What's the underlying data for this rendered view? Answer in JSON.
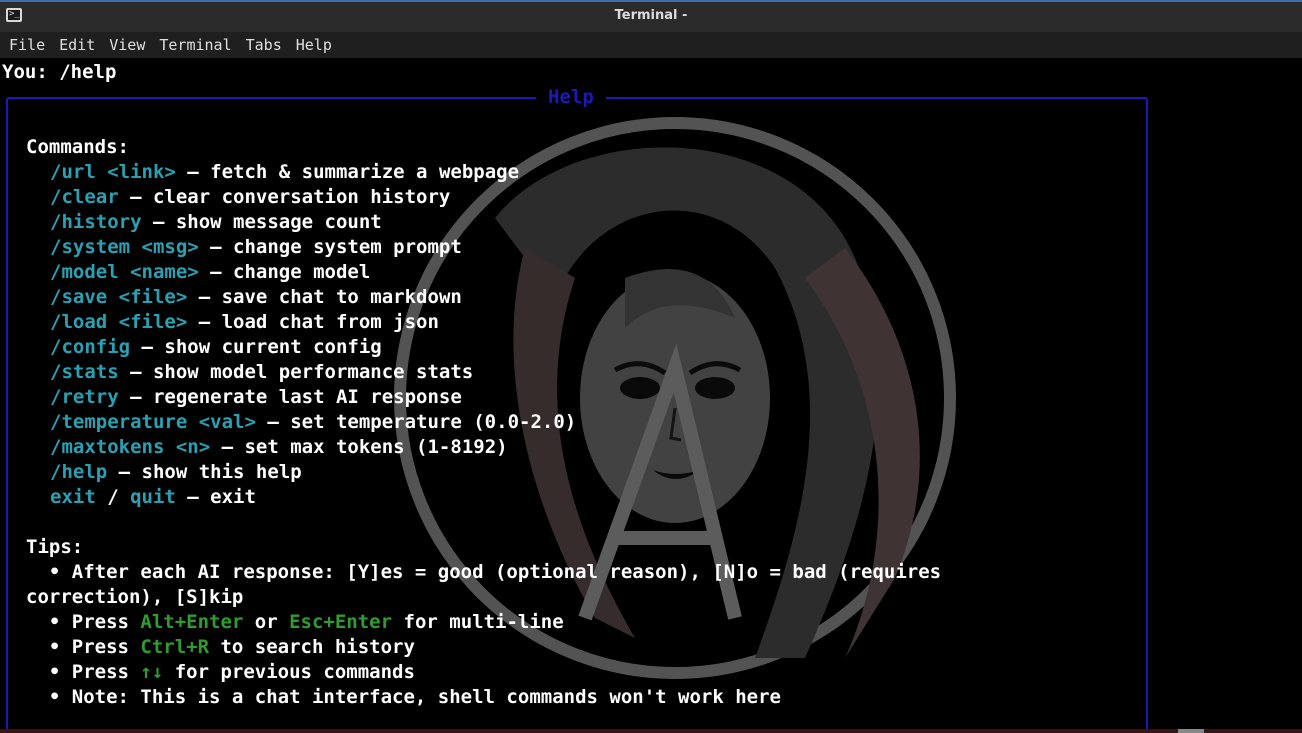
{
  "window": {
    "title": "Terminal -"
  },
  "menu": [
    "File",
    "Edit",
    "View",
    "Terminal",
    "Tabs",
    "Help"
  ],
  "prompt": {
    "text": "You: /help"
  },
  "panel": {
    "title": "Help",
    "commands_header": "Commands:",
    "commands": [
      {
        "cmd": "/url <link>",
        "desc": " — fetch & summarize a webpage"
      },
      {
        "cmd": "/clear",
        "desc": " — clear conversation history"
      },
      {
        "cmd": "/history",
        "desc": " — show message count"
      },
      {
        "cmd": "/system <msg>",
        "desc": " — change system prompt"
      },
      {
        "cmd": "/model <name>",
        "desc": " — change model"
      },
      {
        "cmd": "/save <file>",
        "desc": " — save chat to markdown"
      },
      {
        "cmd": "/load <file>",
        "desc": " — load chat from json"
      },
      {
        "cmd": "/config",
        "desc": " — show current config"
      },
      {
        "cmd": "/stats",
        "desc": " — show model performance stats"
      },
      {
        "cmd": "/retry",
        "desc": " — regenerate last AI response"
      },
      {
        "cmd": "/temperature <val>",
        "desc": " — set temperature (0.0-2.0)"
      },
      {
        "cmd": "/maxtokens <n>",
        "desc": " — set max tokens (1-8192)"
      },
      {
        "cmd": "/help",
        "desc": " — show this help"
      }
    ],
    "exit_line": {
      "cmd1": "exit",
      "sep": " / ",
      "cmd2": "quit",
      "desc": " — exit"
    },
    "tips_header": "Tips:",
    "tips": {
      "tip1_a": "  • After each AI response: [Y]es = good (optional reason), [N]o = bad (requires",
      "tip1_b": "correction), [S]kip",
      "tip2_pre": "  • Press ",
      "tip2_key1": "Alt+Enter",
      "tip2_mid": " or ",
      "tip2_key2": "Esc+Enter",
      "tip2_post": " for multi-line",
      "tip3_pre": "  • Press ",
      "tip3_key": "Ctrl+R",
      "tip3_post": " to search history",
      "tip4_pre": "  • Press ",
      "tip4_key": "↑↓",
      "tip4_post": " for previous commands",
      "tip5": "  • Note: This is a chat interface, shell commands won't work here"
    }
  },
  "colors": {
    "command": "#2aa1b3",
    "key": "#2e9c2e",
    "border": "#1a1ab8",
    "text": "#ffffff"
  },
  "icons": {
    "app": "terminal-icon",
    "watermark": "ai-logo-watermark"
  }
}
